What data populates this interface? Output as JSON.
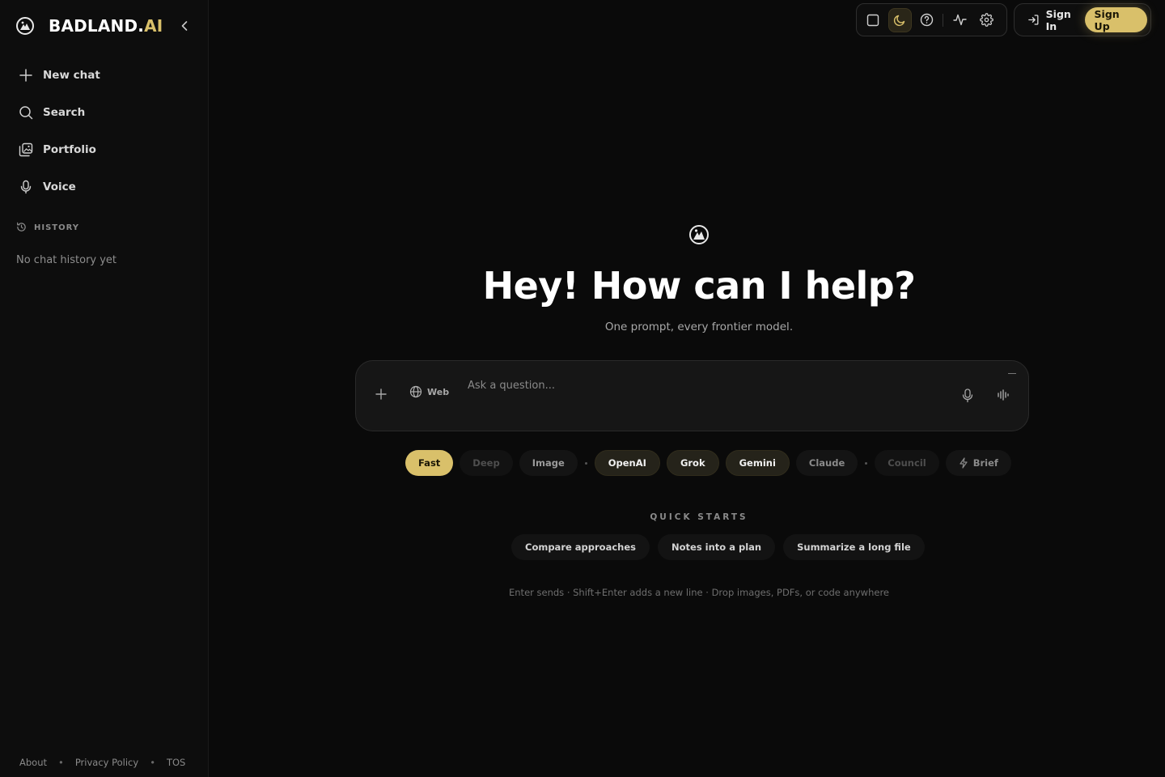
{
  "brand": {
    "name_main": "BADLAND.",
    "name_accent": "AI"
  },
  "sidebar": {
    "items": [
      {
        "label": "New chat",
        "icon": "plus-icon"
      },
      {
        "label": "Search",
        "icon": "search-icon"
      },
      {
        "label": "Portfolio",
        "icon": "image-gallery-icon"
      },
      {
        "label": "Voice",
        "icon": "microphone-icon"
      }
    ],
    "history_label": "HISTORY",
    "history_empty": "No chat history yet"
  },
  "footer": {
    "about": "About",
    "privacy": "Privacy Policy",
    "tos": "TOS",
    "separator": "•"
  },
  "toolbar": {
    "icons": [
      "square-icon",
      "moon-icon",
      "help-icon",
      "activity-icon",
      "gear-icon"
    ],
    "active": "moon-icon"
  },
  "auth": {
    "sign_in": "Sign In",
    "sign_up": "Sign Up"
  },
  "hero": {
    "title": "Hey! How can I help?",
    "subtitle": "One prompt, every frontier model."
  },
  "prompt": {
    "placeholder": "Ask a question...",
    "web_label": "Web",
    "value": ""
  },
  "modes": {
    "fast": "Fast",
    "deep": "Deep",
    "image": "Image",
    "openai": "OpenAI",
    "grok": "Grok",
    "gemini": "Gemini",
    "claude": "Claude",
    "council": "Council",
    "brief": "Brief",
    "selected": "Fast"
  },
  "quick_starts": {
    "heading": "QUICK STARTS",
    "items": [
      "Compare approaches",
      "Notes into a plan",
      "Summarize a long file"
    ]
  },
  "hint": "Enter sends · Shift+Enter adds a new line · Drop images, PDFs, or code anywhere",
  "colors": {
    "accent": "#d9c06a",
    "background": "#0a0a0a",
    "sidebar": "#0d0d0d"
  }
}
